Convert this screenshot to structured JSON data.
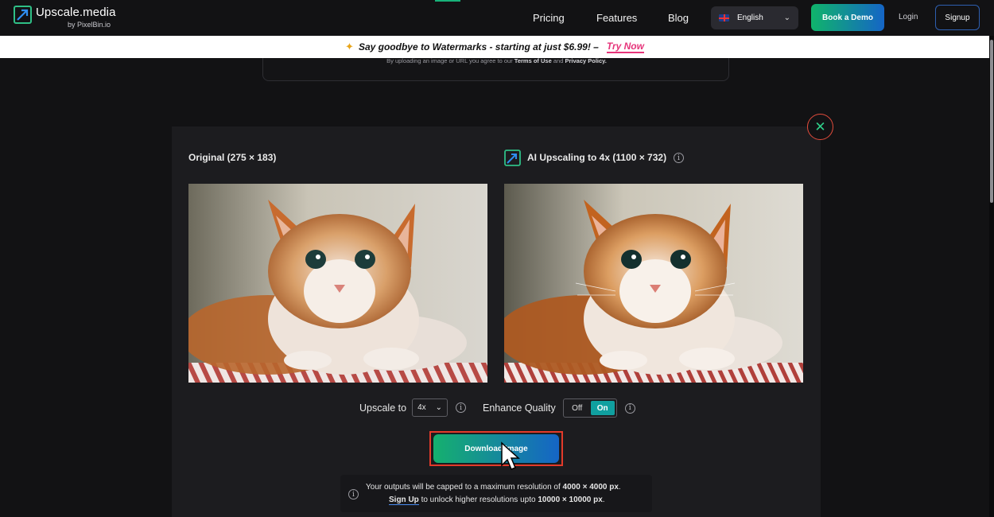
{
  "header": {
    "brand_name": "Upscale.media",
    "brand_sub": "by PixelBin.io",
    "nav": {
      "pricing": "Pricing",
      "features": "Features",
      "blog": "Blog"
    },
    "language": "English",
    "book_demo": "Book a Demo",
    "login": "Login",
    "signup": "Signup"
  },
  "promo": {
    "text": "Say goodbye to Watermarks - starting at just $6.99! –",
    "link": "Try Now"
  },
  "upload": {
    "terms_prefix": "By uploading an image or URL you agree to our",
    "terms_link": "Terms of Use",
    "and": "and",
    "privacy_link": "Privacy Policy."
  },
  "result": {
    "original_title": "Original (275 × 183)",
    "upscaled_title": "AI Upscaling to 4x (1100 × 732)",
    "upscale_label": "Upscale to",
    "upscale_value": "4x",
    "enhance_label": "Enhance Quality",
    "toggle_off": "Off",
    "toggle_on": "On",
    "download_label": "Download Image",
    "note_line1_prefix": "Your outputs will be capped to a maximum resolution of",
    "note_line1_value": "4000 × 4000 px",
    "note_signup": "Sign Up",
    "note_line2_mid": "to unlock higher resolutions upto",
    "note_line2_value": "10000 × 10000 px"
  },
  "colors": {
    "accent_green": "#15b06e",
    "accent_blue": "#1565c6",
    "promo_link": "#e6347a",
    "highlight_outline": "#e33a2a"
  }
}
